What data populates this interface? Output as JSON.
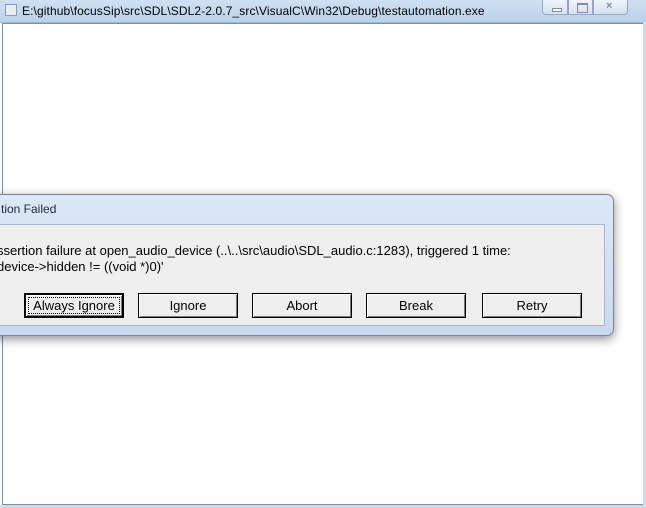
{
  "window": {
    "title": "E:\\github\\focusSip\\src\\SDL\\SDL2-2.0.7_src\\VisualC\\Win32\\Debug\\testautomation.exe",
    "caption_buttons": [
      "minimize",
      "maximize",
      "close"
    ],
    "close_glyph": "×"
  },
  "dialog": {
    "title": "tion Failed",
    "message_line_1": "ssertion failure at open_audio_device (..\\..\\src\\audio\\SDL_audio.c:1283), triggered 1 time:",
    "message_line_2": "device->hidden != ((void *)0)'",
    "buttons": {
      "always_ignore": "Always Ignore",
      "ignore": "Ignore",
      "abort": "Abort",
      "break": "Break",
      "retry": "Retry"
    },
    "default_button": "always_ignore"
  },
  "colors": {
    "titlebar": "#bad2ec",
    "dialog_frame": "#c9daee",
    "dialog_body": "#efefef"
  }
}
